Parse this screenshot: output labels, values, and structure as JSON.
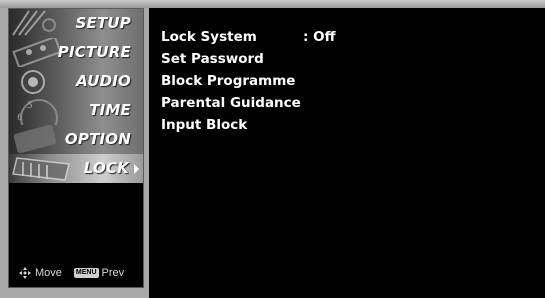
{
  "sidebar": {
    "items": [
      {
        "label": "SETUP",
        "selected": false
      },
      {
        "label": "PICTURE",
        "selected": false
      },
      {
        "label": "AUDIO",
        "selected": false
      },
      {
        "label": "TIME",
        "selected": false
      },
      {
        "label": "OPTION",
        "selected": false
      },
      {
        "label": "LOCK",
        "selected": true
      }
    ]
  },
  "footer": {
    "move_label": "Move",
    "menu_key_label": "MENU",
    "prev_label": "Prev"
  },
  "lock_menu": {
    "options": [
      {
        "label": "Lock System",
        "value": ": Off"
      },
      {
        "label": "Set Password",
        "value": ""
      },
      {
        "label": "Block Programme",
        "value": ""
      },
      {
        "label": "Parental Guidance",
        "value": ""
      },
      {
        "label": "Input Block",
        "value": ""
      }
    ]
  }
}
